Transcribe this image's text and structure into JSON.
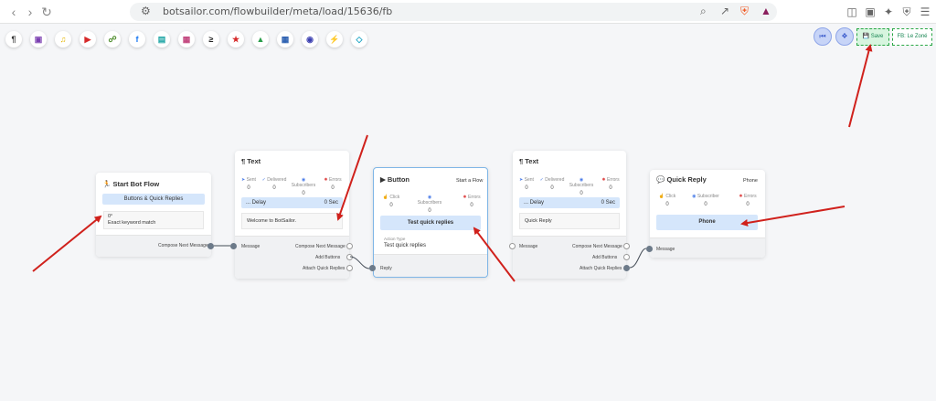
{
  "browser": {
    "url": "botsailor.com/flowbuilder/meta/load/15636/fb",
    "brave_badge": "1"
  },
  "toolbar": {
    "tools": [
      "paragraph-icon",
      "media-icon",
      "audio-icon",
      "video-icon",
      "attachment-icon",
      "facebook-icon",
      "card-icon",
      "gallery-icon",
      "condition-icon",
      "ai-icon",
      "chart-icon",
      "sheet-icon",
      "bot-icon",
      "plug-icon",
      "integration-icon"
    ],
    "save_label": "Save",
    "fb_label": "FB: Le Zoné"
  },
  "nodes": {
    "start": {
      "title": "Start Bot Flow",
      "tag": "Buttons & Quick Replies",
      "keyword": "0°",
      "match": "Exact keyword match",
      "port_label": "Compose Next Message"
    },
    "text1": {
      "title": "Text",
      "stats": [
        {
          "label": "Sent",
          "value": "0"
        },
        {
          "label": "Delivered",
          "value": "0"
        },
        {
          "label": "Subscribers",
          "value": "0"
        },
        {
          "label": "Errors",
          "value": "0"
        }
      ],
      "delay_label": "... Delay",
      "delay_value": "0 Sec",
      "message": "Welcome to BotSailor.",
      "in_label": "Message",
      "out_labels": [
        "Compose Next Message",
        "Add Buttons",
        "Attach Quick Replies"
      ]
    },
    "button": {
      "title": "Button",
      "start_flow": "Start a Flow",
      "stats": [
        {
          "label": "Click",
          "value": "0"
        },
        {
          "label": "Subscribers",
          "value": "0"
        },
        {
          "label": "Errors",
          "value": "0"
        }
      ],
      "button_label": "Test quick replies",
      "action_type_label": "Action Type",
      "action_type_value": "Test quick replies",
      "in_label": "Reply"
    },
    "text2": {
      "title": "Text",
      "stats": [
        {
          "label": "Sent",
          "value": "0"
        },
        {
          "label": "Delivered",
          "value": "0"
        },
        {
          "label": "Subscribers",
          "value": "0"
        },
        {
          "label": "Errors",
          "value": "0"
        }
      ],
      "delay_label": "... Delay",
      "delay_value": "0 Sec",
      "message": "Quick Reply",
      "in_label": "Message",
      "out_labels": [
        "Compose Next Message",
        "Add Buttons",
        "Attach Quick Replies"
      ]
    },
    "quick": {
      "title": "Quick Reply",
      "type": "Phone",
      "stats": [
        {
          "label": "Click",
          "value": "0"
        },
        {
          "label": "Subscriber",
          "value": "0"
        },
        {
          "label": "Errors",
          "value": "0"
        }
      ],
      "button_label": "Phone",
      "in_label": "Message"
    }
  },
  "colors": {
    "accent": "#4c7de8",
    "annotation_arrow": "#d0211c",
    "save_green": "#198754",
    "connector": "#444c56"
  }
}
